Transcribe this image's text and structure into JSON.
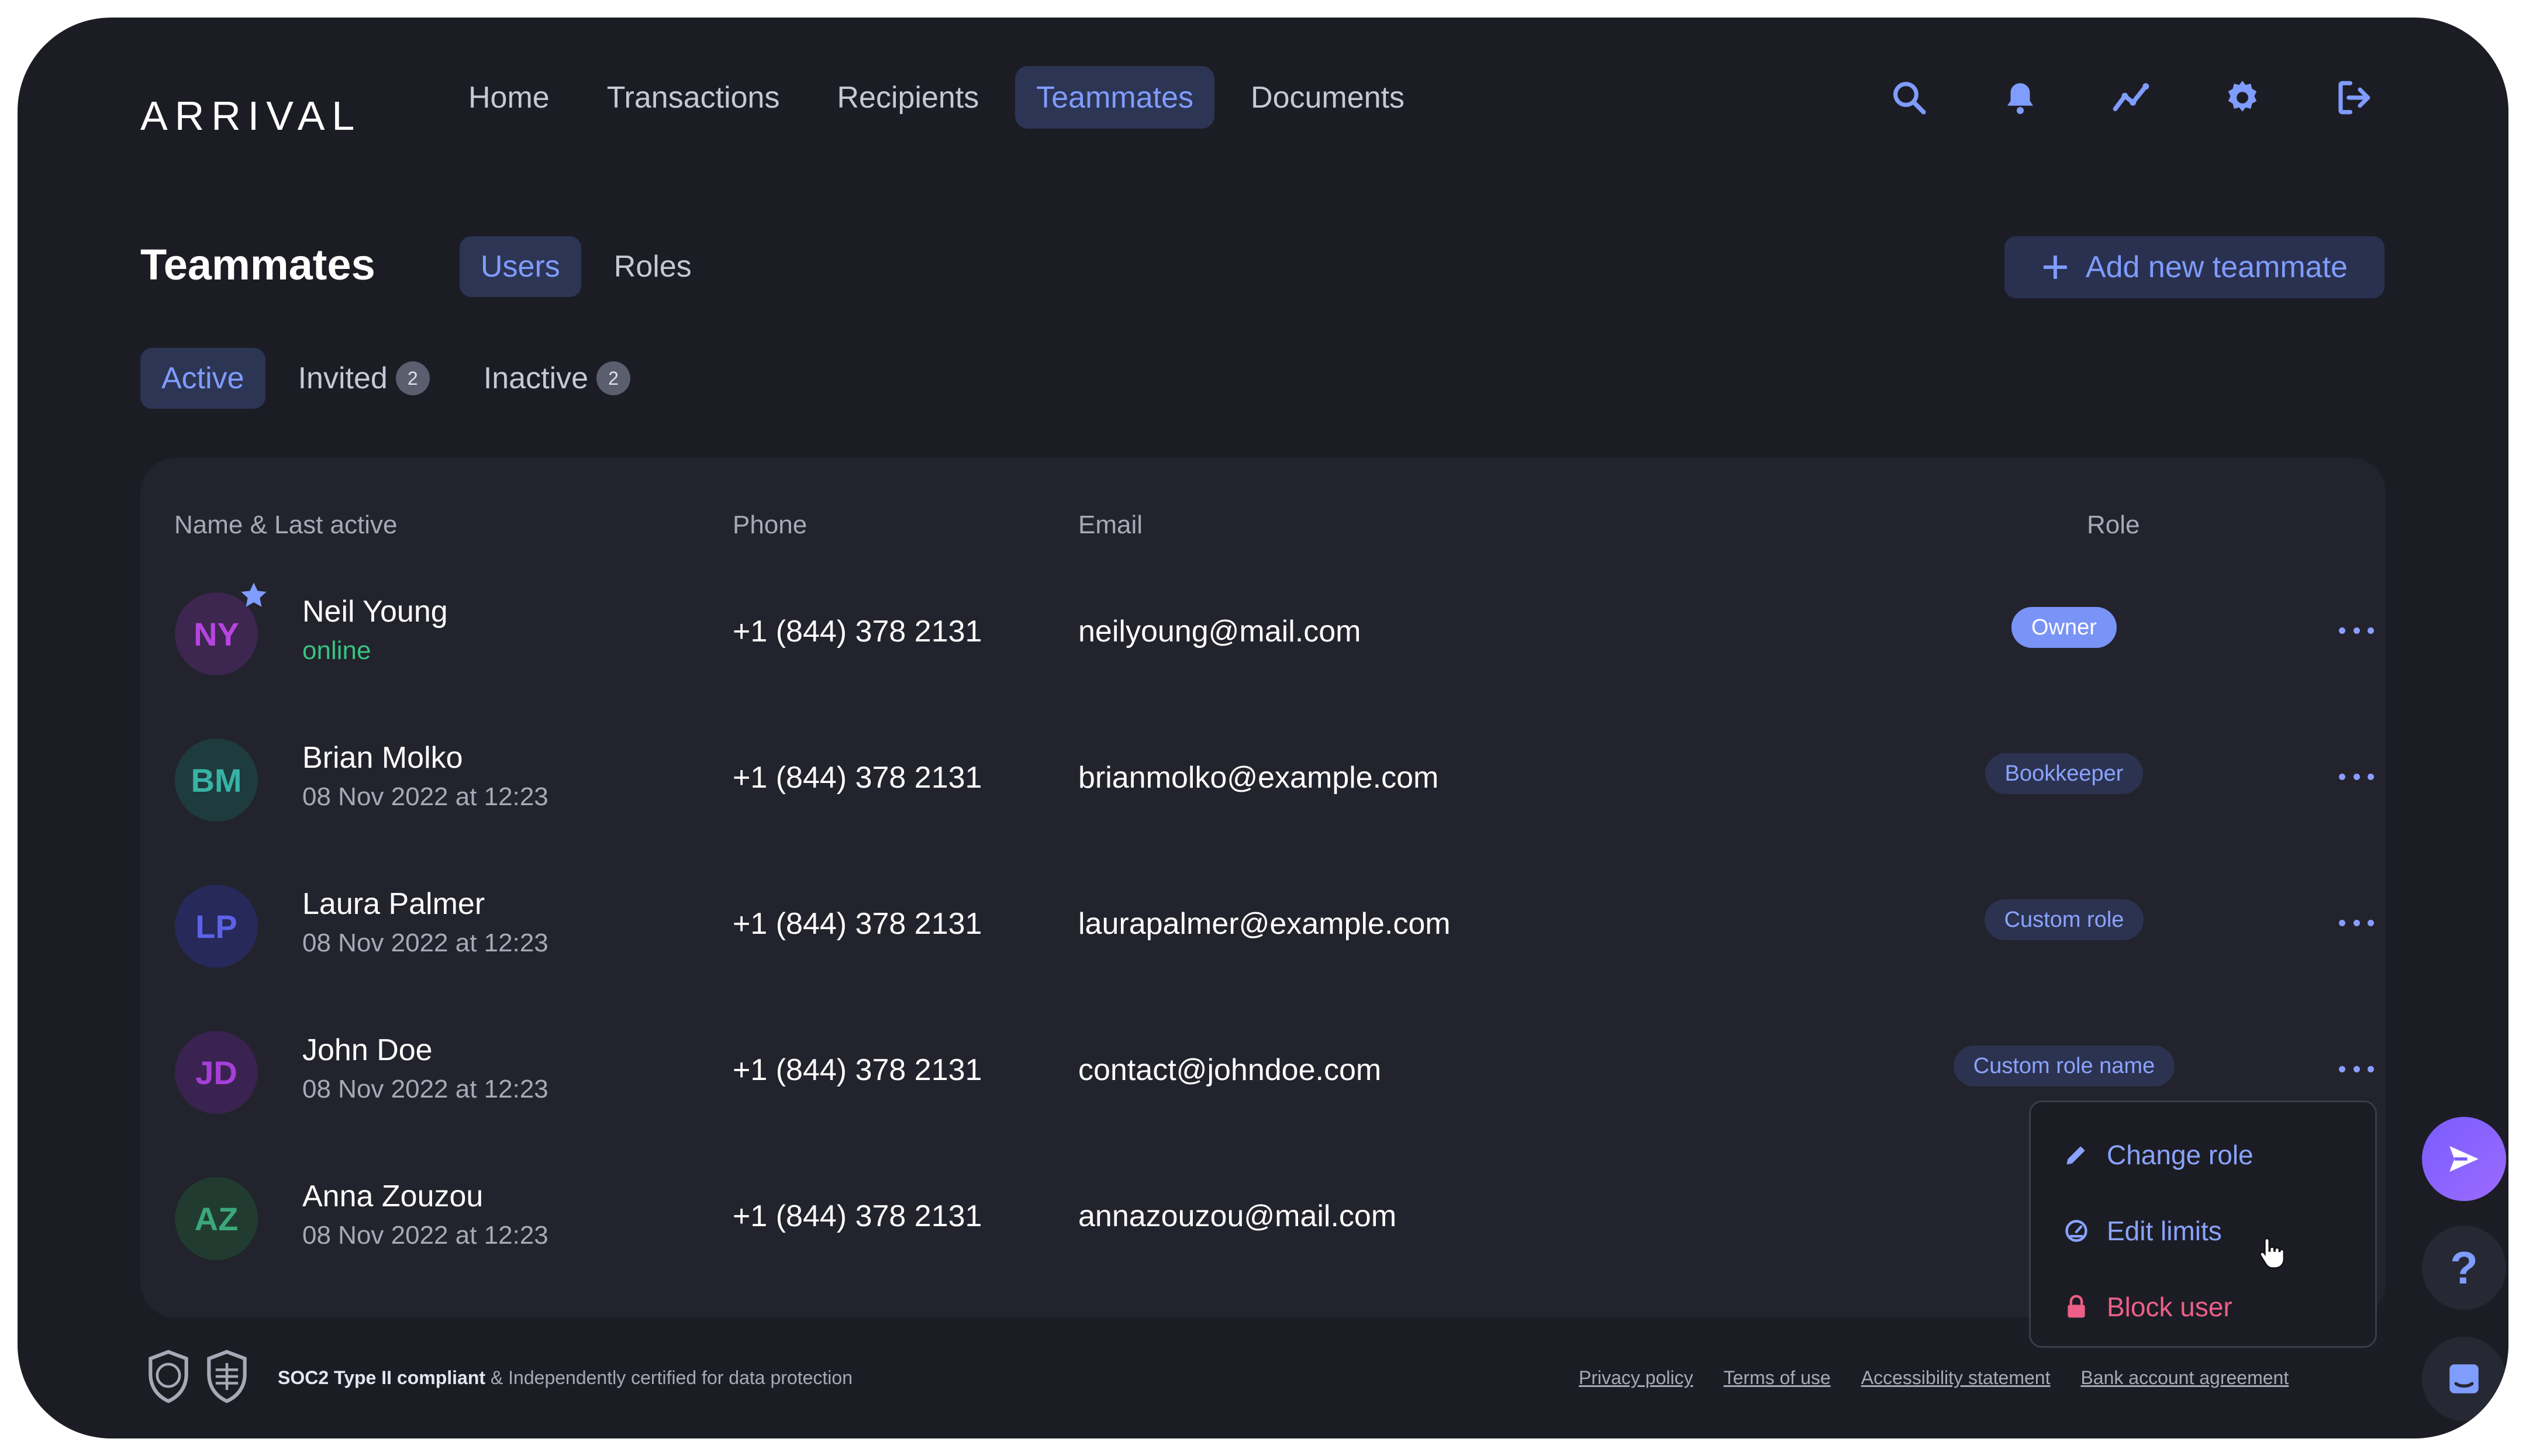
{
  "app": {
    "logo": "ARRIVAL"
  },
  "nav": {
    "items": [
      {
        "label": "Home",
        "active": false
      },
      {
        "label": "Transactions",
        "active": false
      },
      {
        "label": "Recipients",
        "active": false
      },
      {
        "label": "Teammates",
        "active": true
      },
      {
        "label": "Documents",
        "active": false
      }
    ],
    "icons": [
      "search-icon",
      "bell-icon",
      "analytics-icon",
      "gear-icon",
      "logout-icon"
    ]
  },
  "header": {
    "title": "Teammates",
    "segments": [
      {
        "label": "Users",
        "active": true
      },
      {
        "label": "Roles",
        "active": false
      }
    ],
    "add_button": "Add new teammate"
  },
  "status_tabs": [
    {
      "label": "Active",
      "count": null,
      "active": true
    },
    {
      "label": "Invited",
      "count": "2",
      "active": false
    },
    {
      "label": "Inactive",
      "count": "2",
      "active": false
    }
  ],
  "table": {
    "columns": [
      "Name & Last active",
      "Phone",
      "Email",
      "Role"
    ],
    "rows": [
      {
        "initials": "NY",
        "name": "Neil Young",
        "last_active": "online",
        "phone": "+1 (844) 378 2131",
        "email": "neilyoung@mail.com",
        "role": "Owner",
        "favorite": true
      },
      {
        "initials": "BM",
        "name": "Brian Molko",
        "last_active": "08 Nov 2022 at 12:23",
        "phone": "+1 (844) 378 2131",
        "email": "brianmolko@example.com",
        "role": "Bookkeeper",
        "favorite": false
      },
      {
        "initials": "LP",
        "name": "Laura Palmer",
        "last_active": "08 Nov 2022 at 12:23",
        "phone": "+1 (844) 378 2131",
        "email": "laurapalmer@example.com",
        "role": "Custom role",
        "favorite": false
      },
      {
        "initials": "JD",
        "name": "John Doe",
        "last_active": "08 Nov 2022 at 12:23",
        "phone": "+1 (844) 378 2131",
        "email": "contact@johndoe.com",
        "role": "Custom role name",
        "favorite": false
      },
      {
        "initials": "AZ",
        "name": "Anna Zouzou",
        "last_active": "08 Nov 2022 at 12:23",
        "phone": "+1 (844) 378 2131",
        "email": "annazouzou@mail.com",
        "role": "",
        "favorite": false
      }
    ]
  },
  "row_menu": {
    "items": [
      {
        "label": "Change role",
        "icon": "pencil-icon"
      },
      {
        "label": "Edit limits",
        "icon": "gauge-icon"
      },
      {
        "label": "Block user",
        "icon": "lock-icon"
      }
    ]
  },
  "footer": {
    "compliance_bold": "SOC2 Type II compliant",
    "compliance_rest": " & Independently certified for data protection",
    "links": [
      "Privacy policy",
      "Terms of use",
      "Accessibility statement",
      "Bank account agreement"
    ]
  },
  "colors": {
    "background": "#1c1d24",
    "accent": "#7f9cff",
    "online": "#39c281",
    "danger": "#ec5f87",
    "owner_badge": "#7a93f7"
  }
}
